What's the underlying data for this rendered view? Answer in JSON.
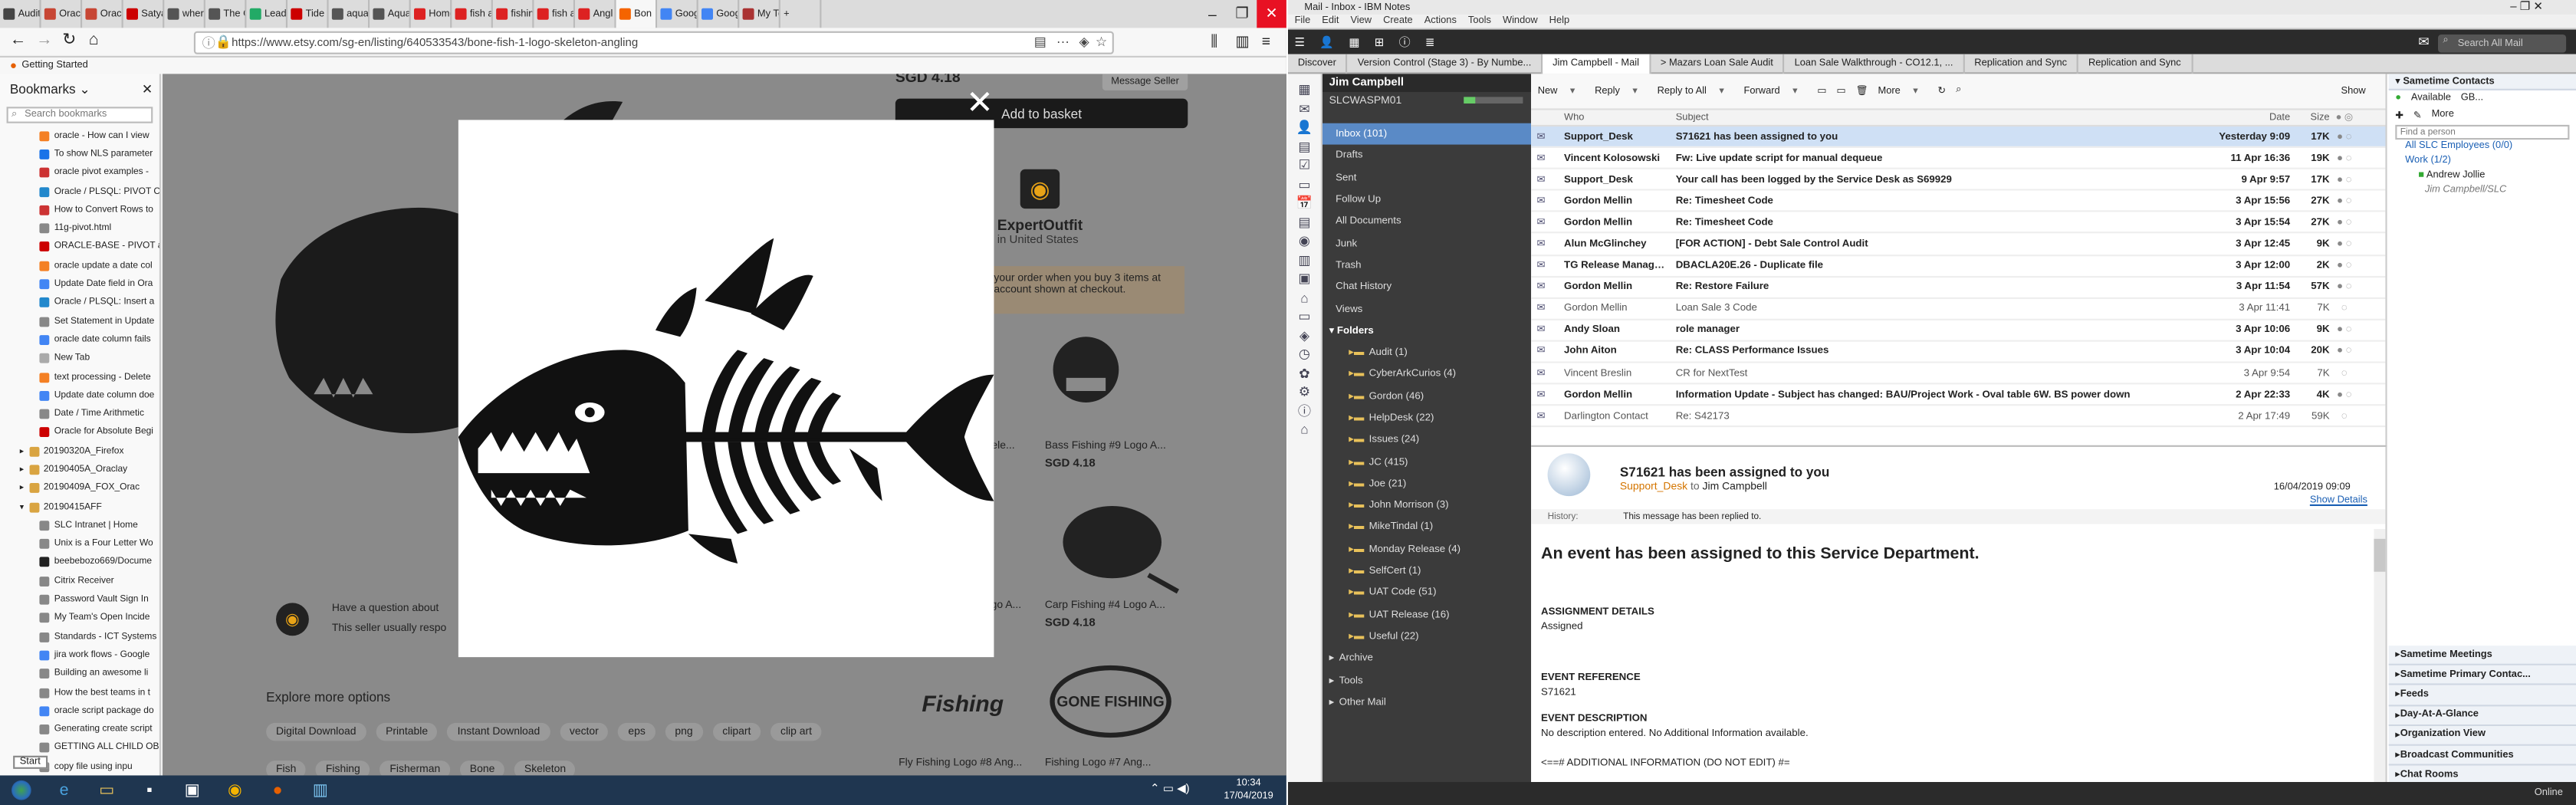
{
  "firefox": {
    "tabs": [
      {
        "label": "Auditi",
        "color": "#444"
      },
      {
        "label": "Oracl",
        "color": "#c74634"
      },
      {
        "label": "Oracl",
        "color": "#c74634"
      },
      {
        "label": "Satya",
        "color": "#c00"
      },
      {
        "label": "where",
        "color": "#555"
      },
      {
        "label": "The Glasg",
        "color": "#555"
      },
      {
        "label": "Lead",
        "color": "#2a6"
      },
      {
        "label": "Tide",
        "color": "#c00"
      },
      {
        "label": "aquar",
        "color": "#555"
      },
      {
        "label": "Aqua",
        "color": "#555"
      },
      {
        "label": "Home",
        "color": "#d22"
      },
      {
        "label": "fish a",
        "color": "#d22"
      },
      {
        "label": "fishin",
        "color": "#d22"
      },
      {
        "label": "fish ar",
        "color": "#d22"
      },
      {
        "label": "Angl",
        "color": "#d22"
      },
      {
        "label": "Bon",
        "color": "#f56400"
      },
      {
        "label": "Goog",
        "color": "#4285f4"
      },
      {
        "label": "Goog",
        "color": "#4285f4"
      },
      {
        "label": "My Te",
        "color": "#a33"
      }
    ],
    "url": "https://www.etsy.com/sg-en/listing/640533543/bone-fish-1-logo-skeleton-angling",
    "getting_started": "Getting Started",
    "sidebar_title": "Bookmarks",
    "sidebar_search_placeholder": "Search bookmarks",
    "bookmarks": [
      {
        "label": "oracle - How can I view",
        "color": "#f48024",
        "type": "item"
      },
      {
        "label": "To show NLS parameter",
        "color": "#1a73e8",
        "type": "item"
      },
      {
        "label": "oracle pivot examples -",
        "color": "#c33",
        "type": "item"
      },
      {
        "label": "Oracle / PLSQL: PIVOT C",
        "color": "#28c",
        "type": "item"
      },
      {
        "label": "How to Convert Rows to",
        "color": "#c33",
        "type": "item"
      },
      {
        "label": "11g-pivot.html",
        "color": "#888",
        "type": "item"
      },
      {
        "label": "ORACLE-BASE - PIVOT ar",
        "color": "#c00",
        "type": "item"
      },
      {
        "label": "oracle update a date col",
        "color": "#f48024",
        "type": "item"
      },
      {
        "label": "Update Date field in Ora",
        "color": "#4285f4",
        "type": "item"
      },
      {
        "label": "Oracle / PLSQL: Insert a",
        "color": "#28c",
        "type": "item"
      },
      {
        "label": "Set Statement in Update",
        "color": "#888",
        "type": "item"
      },
      {
        "label": "oracle date column fails",
        "color": "#4285f4",
        "type": "item"
      },
      {
        "label": "New Tab",
        "color": "#aaa",
        "type": "item"
      },
      {
        "label": "text processing - Delete",
        "color": "#f48024",
        "type": "item"
      },
      {
        "label": "Update date column doe",
        "color": "#4285f4",
        "type": "item"
      },
      {
        "label": "Date / Time Arithmetic",
        "color": "#888",
        "type": "item"
      },
      {
        "label": "Oracle for Absolute Begi",
        "color": "#c00",
        "type": "item"
      },
      {
        "label": "20190320A_Firefox",
        "color": "#d9a441",
        "type": "folder"
      },
      {
        "label": "20190405A_Oraclay",
        "color": "#d9a441",
        "type": "folder"
      },
      {
        "label": "20190409A_FOX_Orac",
        "color": "#d9a441",
        "type": "folder"
      },
      {
        "label": "20190415AFF",
        "color": "#d9a441",
        "type": "folder"
      },
      {
        "label": "SLC Intranet | Home",
        "color": "#888",
        "type": "child"
      },
      {
        "label": "Unix is a Four Letter Wo",
        "color": "#888",
        "type": "child"
      },
      {
        "label": "beebebozo669/Docume",
        "color": "#222",
        "type": "child"
      },
      {
        "label": "Citrix Receiver",
        "color": "#888",
        "type": "child"
      },
      {
        "label": "Password Vault Sign In",
        "color": "#888",
        "type": "child"
      },
      {
        "label": "My Team's Open Incide",
        "color": "#888",
        "type": "child"
      },
      {
        "label": "Standards - ICT Systems",
        "color": "#888",
        "type": "child"
      },
      {
        "label": "jira work flows - Google",
        "color": "#4285f4",
        "type": "child"
      },
      {
        "label": "Building an awesome li",
        "color": "#888",
        "type": "child"
      },
      {
        "label": "How the best teams in t",
        "color": "#888",
        "type": "child"
      },
      {
        "label": "oracle script package do",
        "color": "#4285f4",
        "type": "child"
      },
      {
        "label": "Generating create script",
        "color": "#888",
        "type": "child"
      },
      {
        "label": "GETTING ALL CHILD OB",
        "color": "#888",
        "type": "child"
      },
      {
        "label": "copy file using inpu",
        "color": "#888",
        "type": "child"
      }
    ],
    "start_tooltip": "Start"
  },
  "etsy": {
    "price_top": "SGD 4.18",
    "message_seller": "Message Seller",
    "add_to_basket": "Add to basket",
    "shop_name": "ExpertOutfit",
    "shop_location": "in United States",
    "promo_line1": "your order when you buy 3 items at",
    "promo_line2": "account shown at checkout.",
    "skele": "Skele...",
    "bass_title": "Bass Fishing #9 Logo A...",
    "bass_price": "SGD 4.18",
    "carp_title": "Carp Fishing #4 Logo A...",
    "carp_price": "SGD 4.18",
    "logo_a": "Logo A...",
    "question": "Have a question about",
    "seller_respond": "This seller usually respo",
    "explore_more": "Explore more options",
    "tags": [
      "Digital Download",
      "Printable",
      "Instant Download",
      "vector",
      "eps",
      "png",
      "clipart",
      "clip art"
    ],
    "tags2": [
      "Fish",
      "Fishing",
      "Fisherman",
      "Bone",
      "Skeleton"
    ],
    "fly_title": "Fly Fishing Logo #8 Ang...",
    "gone_title": "Fishing Logo #7 Ang...",
    "fishing_logo_text": "Fishing",
    "gone_fishing_text": "GONE FISHING"
  },
  "taskbar": {
    "time": "10:34",
    "date": "17/04/2019"
  },
  "notes": {
    "window_title": "Mail - Inbox - IBM Notes",
    "menu": [
      "File",
      "Edit",
      "View",
      "Create",
      "Actions",
      "Tools",
      "Window",
      "Help"
    ],
    "search_placeholder": "Search All Mail",
    "tabs": [
      "Discover",
      "Version Control (Stage 3) - By Numbe...",
      "Jim Campbell - Mail",
      "> Mazars Loan Sale Audit",
      "Loan Sale Walkthrough - CO12.1, ...",
      "Replication and Sync",
      "Replication and Sync"
    ],
    "active_tab": 2,
    "user": "Jim Campbell",
    "server": "SLCWASPM01",
    "nav": [
      {
        "label": "Inbox (101)",
        "sel": true
      },
      {
        "label": "Drafts"
      },
      {
        "label": "Sent"
      },
      {
        "label": "Follow Up"
      },
      {
        "label": "All Documents"
      },
      {
        "label": "Junk"
      },
      {
        "label": "Trash"
      },
      {
        "label": "Chat History"
      },
      {
        "label": "Views"
      }
    ],
    "folders_label": "Folders",
    "folders": [
      "Audit (1)",
      "CyberArkCurios (4)",
      "Gordon (46)",
      "HelpDesk (22)",
      "Issues (24)",
      "JC (415)",
      "Joe (21)",
      "John Morrison (3)",
      "MikeTindal (1)",
      "Monday Release (4)",
      "SelfCert (1)",
      "UAT Code (51)",
      "UAT Release (16)",
      "Useful (22)"
    ],
    "nav_bottom": [
      "Archive",
      "Tools",
      "Other Mail"
    ],
    "actions": [
      "New",
      "Reply",
      "Reply to All",
      "Forward",
      "More",
      "Show"
    ],
    "columns": {
      "who": "Who",
      "subject": "Subject",
      "date": "Date",
      "size": "Size"
    },
    "messages": [
      {
        "who": "Support_Desk",
        "subject": "S71621 has been assigned to you",
        "date": "Yesterday  9:09",
        "size": "17K",
        "unread": true,
        "sel": true
      },
      {
        "who": "Vincent Kolosowski",
        "subject": "Fw: Live update script for manual dequeue",
        "date": "11 Apr 16:36",
        "size": "19K",
        "unread": true
      },
      {
        "who": "Support_Desk",
        "subject": "Your call has been logged by the Service Desk as S69929",
        "date": "9 Apr  9:57",
        "size": "17K",
        "unread": true
      },
      {
        "who": "Gordon Mellin",
        "subject": "Re: Timesheet Code",
        "date": "3 Apr 15:56",
        "size": "27K",
        "unread": true
      },
      {
        "who": "Gordon Mellin",
        "subject": "Re: Timesheet Code",
        "date": "3 Apr 15:54",
        "size": "27K",
        "unread": true
      },
      {
        "who": "Alun McGlinchey",
        "subject": "[FOR ACTION] - Debt Sale Control Audit",
        "date": "3 Apr 12:45",
        "size": "9K",
        "unread": true
      },
      {
        "who": "TG Release Management",
        "subject": "DBACLA20E.26 - Duplicate file",
        "date": "3 Apr 12:00",
        "size": "2K",
        "unread": true
      },
      {
        "who": "Gordon Mellin",
        "subject": "Re: Restore Failure",
        "date": "3 Apr 11:54",
        "size": "57K",
        "unread": true
      },
      {
        "who": "Gordon Mellin",
        "subject": "Loan Sale 3 Code",
        "date": "3 Apr 11:41",
        "size": "7K",
        "unread": false
      },
      {
        "who": "Andy Sloan",
        "subject": "role manager",
        "date": "3 Apr 10:06",
        "size": "9K",
        "unread": true
      },
      {
        "who": "John Aiton",
        "subject": "Re: CLASS Performance Issues",
        "date": "3 Apr 10:04",
        "size": "20K",
        "unread": true
      },
      {
        "who": "Vincent Breslin",
        "subject": "CR for NextTest",
        "date": "3 Apr  9:54",
        "size": "7K",
        "unread": false
      },
      {
        "who": "Gordon Mellin",
        "subject": "Information Update - Subject has changed: BAU/Project Work - Oval table 6W. BS power down",
        "date": "2 Apr 22:33",
        "size": "4K",
        "unread": true
      },
      {
        "who": "Darlington Contact",
        "subject": "Re: S42173",
        "date": "2 Apr 17:49",
        "size": "59K",
        "unread": false
      }
    ],
    "read": {
      "subject": "S71621 has been assigned to you",
      "from": "Support_Desk",
      "to_prefix": "to",
      "to": "Jim Campbell",
      "date": "16/04/2019 09:09",
      "show_details": "Show Details",
      "history_label": "History:",
      "history_text": "This message has been replied to.",
      "heading": "An event has been assigned to this Service Department.",
      "ad_label": "ASSIGNMENT DETAILS",
      "ad_value": "Assigned",
      "er_label": "EVENT REFERENCE",
      "er_value": "S71621",
      "ed_label": "EVENT DESCRIPTION",
      "ed_value": "No description entered. No Additional Information available.",
      "footer": "<==# ADDITIONAL INFORMATION (DO NOT EDIT) #="
    },
    "right": {
      "contacts": "Sametime Contacts",
      "available": "Available",
      "gb": "GB...",
      "more": "More",
      "find_placeholder": "Find a person",
      "group1": "All SLC Employees (0/0)",
      "group2": "Work (1/2)",
      "person1": "Andrew Jollie",
      "person2": "Jim Campbell/SLC",
      "panels": [
        "Sametime Meetings",
        "Sametime Primary Contac...",
        "Feeds",
        "Day-At-A-Glance",
        "Organization View",
        "Broadcast Communities",
        "Chat Rooms"
      ]
    },
    "status": "Online"
  }
}
